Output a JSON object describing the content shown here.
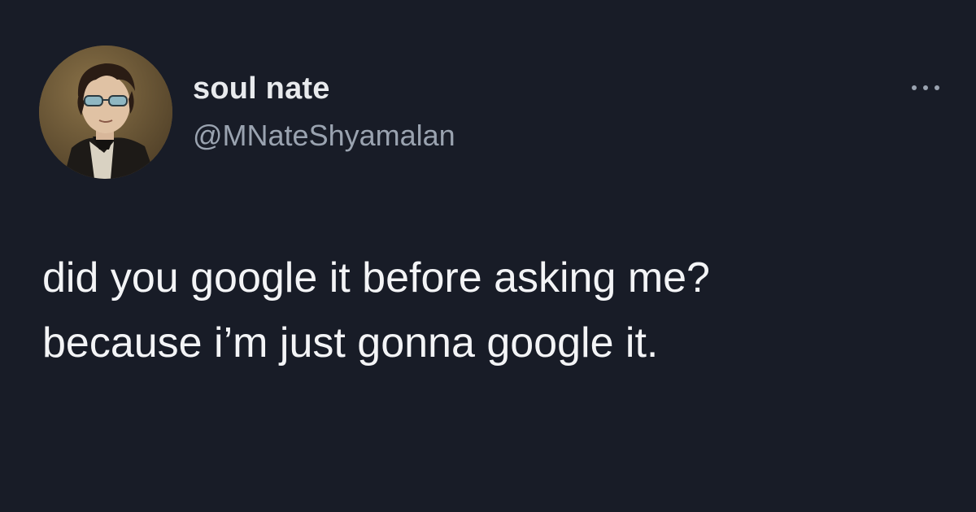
{
  "tweet": {
    "author": {
      "display_name": "soul nate",
      "handle": "@MNateShyamalan",
      "avatar_icon": "portrait-avatar"
    },
    "more_icon": "more-horizontal-icon",
    "text_lines": [
      "did you google it before asking me?",
      "because i’m just gonna google it."
    ]
  },
  "theme": {
    "background": "#181c27",
    "primary_text": "#f3f4f6",
    "secondary_text": "#9aa3b0"
  }
}
